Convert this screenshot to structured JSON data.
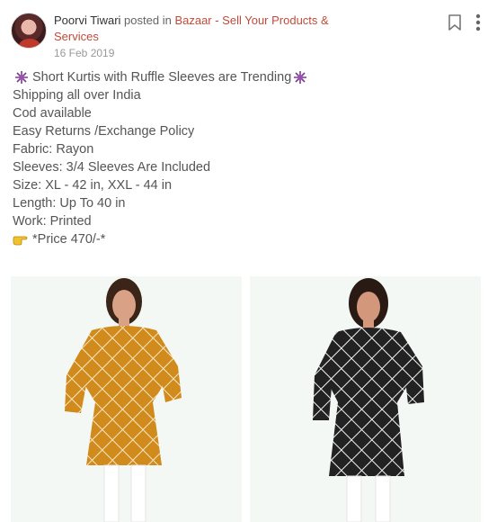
{
  "post": {
    "author": "Poorvi Tiwari",
    "posted_in": "posted in",
    "community": "Bazaar - Sell Your Products & Services",
    "date": "16 Feb 2019"
  },
  "icons": {
    "bookmark": "bookmark-icon",
    "more": "more-vertical-icon",
    "sparkle": "sparkle-emoji-icon",
    "pointing": "pointing-hand-emoji-icon"
  },
  "content": {
    "title": "Short Kurtis with Ruffle Sleeves are Trending",
    "lines": [
      "Shipping all over India",
      "Cod available",
      "Easy Returns /Exchange Policy",
      "Fabric: Rayon",
      "Sleeves: 3/4 Sleeves Are Included",
      "Size: XL - 42 in, XXL - 44 in",
      "Length: Up To 40 in",
      "Work: Printed"
    ],
    "price": "*Price 470/-*"
  },
  "colors": {
    "community_link": "#c24a3a",
    "left_kurti": "#d18a1c",
    "right_kurti": "#222222"
  }
}
